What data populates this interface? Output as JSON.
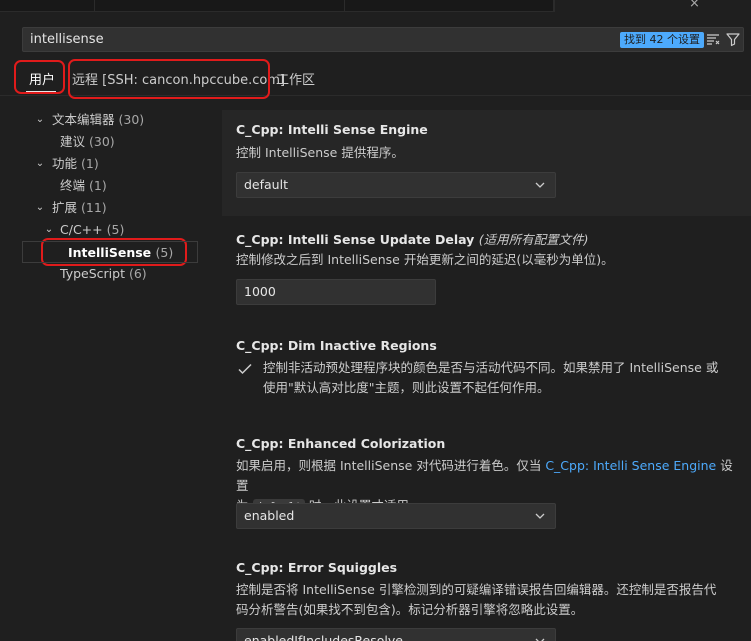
{
  "search": {
    "query": "intellisense",
    "result_count": "找到 42 个设置"
  },
  "scope_tabs": [
    {
      "label": "用户"
    },
    {
      "label": "远程 [SSH: cancon.hpccube.com]"
    },
    {
      "label": "工作区"
    }
  ],
  "toc": [
    {
      "label": "文本编辑器",
      "count": "(30)"
    },
    {
      "label": "建议",
      "count": "(30)"
    },
    {
      "label": "功能",
      "count": "(1)"
    },
    {
      "label": "终端",
      "count": "(1)"
    },
    {
      "label": "扩展",
      "count": "(11)"
    },
    {
      "label": "C/C++",
      "count": "(5)"
    },
    {
      "label": "IntelliSense",
      "count": "(5)"
    },
    {
      "label": "TypeScript",
      "count": "(6)"
    }
  ],
  "settings": {
    "engine": {
      "title": "C_Cpp: Intelli Sense Engine",
      "desc": "控制 IntelliSense 提供程序。",
      "value": "default"
    },
    "update_delay": {
      "title": "C_Cpp: Intelli Sense Update Delay",
      "scope_note": "(适用所有配置文件)",
      "desc": "控制修改之后到 IntelliSense 开始更新之间的延迟(以毫秒为单位)。",
      "value": "1000"
    },
    "dim_inactive": {
      "title": "C_Cpp: Dim Inactive Regions",
      "desc_line1": "控制非活动预处理程序块的颜色是否与活动代码不同。如果禁用了 IntelliSense 或",
      "desc_line2": "使用\"默认高对比度\"主题，则此设置不起任何作用。"
    },
    "colorization": {
      "title": "C_Cpp: Enhanced Colorization",
      "desc_part1": "如果启用，则根据 IntelliSense 对代码进行着色。仅当",
      "desc_link": "C_Cpp: Intelli Sense Engine",
      "desc_part2": "设置",
      "desc_part3": "为",
      "desc_code": "default",
      "desc_part4": "时，此设置才适用。",
      "value": "enabled"
    },
    "squiggles": {
      "title": "C_Cpp: Error Squiggles",
      "desc_line1": "控制是否将 IntelliSense 引擎检测到的可疑编译错误报告回编辑器。还控制是否报告代",
      "desc_line2": "码分析警告(如果找不到包含)。标记分析器引擎将忽略此设置。",
      "value": "enabledIfIncludesResolve"
    }
  },
  "colors": {
    "accent": "#4daafc",
    "highlight": "#e01b1b",
    "background": "#1f1f1f"
  }
}
